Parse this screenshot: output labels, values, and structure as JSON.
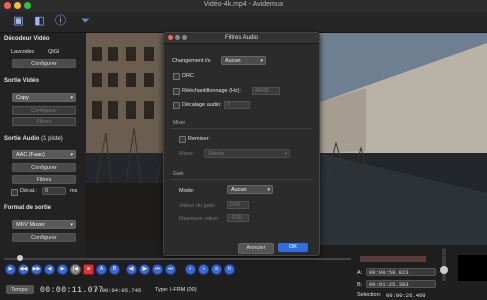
{
  "window": {
    "title": "Vidéo-4k.mp4 - Avidemux"
  },
  "toolbar": {
    "icons": [
      "open-file-icon",
      "save-icon",
      "info-icon",
      "filter-icon"
    ]
  },
  "left": {
    "video_decoder": {
      "heading": "Décodeur Vidéo",
      "lavcodec_label": "Lavcodec",
      "lavcodec_value": "QtGl",
      "configure": "Configurer"
    },
    "video_output": {
      "heading": "Sortie Vidéo",
      "codec": "Copy",
      "configure": "Configurer",
      "filters": "Filtres"
    },
    "audio_output": {
      "heading": "Sortie Audio",
      "tracks": "(1 piste)",
      "codec": "AAC (Faac)",
      "configure": "Configurer",
      "filters": "Filtres",
      "shift_label": "Décal.:",
      "shift_value": "0",
      "shift_unit": "ms"
    },
    "format": {
      "heading": "Format de sortie",
      "muxer": "MKV Muxer",
      "configure": "Configurer"
    }
  },
  "dialog": {
    "title": "Filtres Audio",
    "fps_label": "Changement i/s",
    "fps_value": "Aucun",
    "drc_label": "DRC",
    "resample_label": "Rééchantillonnage (Hz):",
    "resample_value": "44100",
    "delay_label": "Décalage audio:",
    "delay_value": "0",
    "mixer_group": "Mixer",
    "remix_label": "Remixer:",
    "mixer_label": "Mixer:",
    "mixer_value": "Stéréo",
    "gain_group": "Gain",
    "mode_label": "Mode:",
    "mode_value": "Aucun",
    "gain_value_label": "Valeur du gain:",
    "gain_value": "0.00",
    "max_value_label": "Maximum value:",
    "max_value": "-3.00",
    "cancel": "Annuler",
    "ok": "OK"
  },
  "status": {
    "time_button": "Temps:",
    "current_time": "00:00:11.077",
    "duration": "/ 00:04:05.745",
    "frame_type": "Type: I-FRM (00)",
    "a_label": "A:",
    "a_value": "00:00:58.823",
    "b_label": "B:",
    "b_value": "00:01:25.383",
    "selection_label": "Selection:",
    "selection_value": "00:00:26.460"
  },
  "colors": {
    "accent": "#2f6fe0",
    "ok_button": "#2f6fe0",
    "control_buttons": "#3b6ad8"
  }
}
